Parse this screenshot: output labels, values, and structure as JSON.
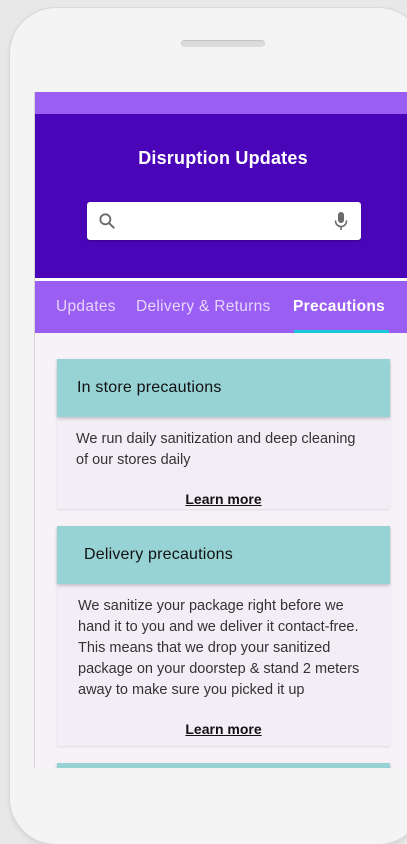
{
  "app": {
    "title": "Disruption Updates"
  },
  "search": {
    "placeholder": "",
    "value": "",
    "icon": "search-icon",
    "voice_icon": "mic-icon"
  },
  "tabs": [
    {
      "label": "Updates",
      "active": false
    },
    {
      "label": "Delivery & Returns",
      "active": false
    },
    {
      "label": "Precautions",
      "active": true
    }
  ],
  "cards": [
    {
      "title": "In store precautions",
      "body": "We run daily sanitization and deep cleaning of our stores daily",
      "link": "Learn more"
    },
    {
      "title": "Delivery precautions",
      "body": "We sanitize your package right before we hand it to you and we deliver it contact-free. This means that we drop your sanitized package on your doorstep & stand 2 meters away to make sure you picked it up",
      "link": "Learn more"
    }
  ],
  "colors": {
    "header": "#4b05b8",
    "accent": "#9a5ff2",
    "tab_indicator": "#19c9d8",
    "card_header": "#97d2d4"
  }
}
